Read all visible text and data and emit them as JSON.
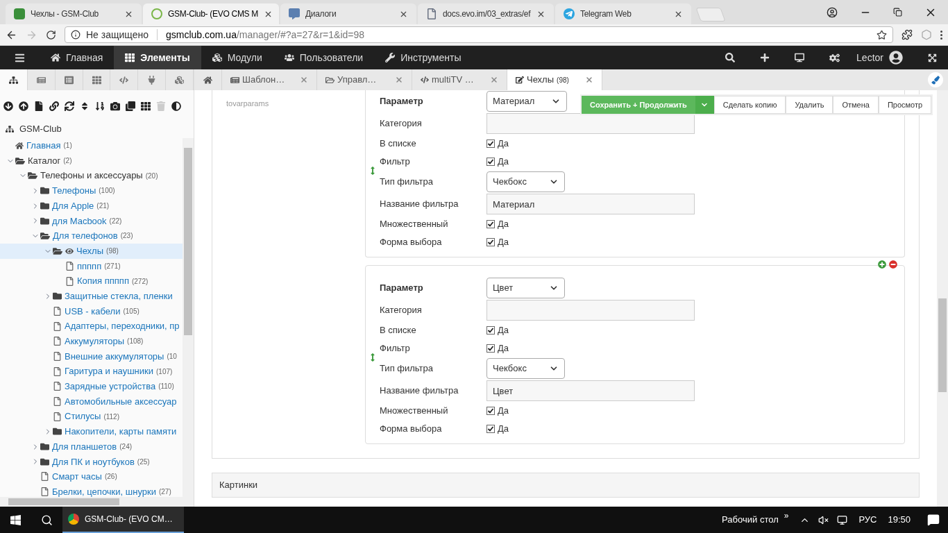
{
  "browser": {
    "tabs": [
      {
        "title": "Чехлы - GSM-Club",
        "kind": "gsm",
        "selected": false
      },
      {
        "title": "GSM-Club- (EVO CMS M",
        "kind": "evo",
        "selected": true
      },
      {
        "title": "Диалоги",
        "kind": "chat",
        "selected": false
      },
      {
        "title": "docs.evo.im/03_extras/ef",
        "kind": "doc",
        "selected": false
      },
      {
        "title": "Telegram Web",
        "kind": "telegram",
        "selected": false
      }
    ],
    "security": "Не защищено",
    "url_host": "gsmclub.com.ua",
    "url_path": "/manager/#?a=27&r=1&id=98"
  },
  "nav": {
    "items": [
      {
        "label": "Главная",
        "kind": "home",
        "selected": false
      },
      {
        "label": "Элементы",
        "kind": "elements",
        "selected": true
      },
      {
        "label": "Модули",
        "kind": "modules",
        "selected": false
      },
      {
        "label": "Пользователи",
        "kind": "users",
        "selected": false
      },
      {
        "label": "Инструменты",
        "kind": "tools",
        "selected": false
      }
    ],
    "user": "Lector"
  },
  "sidebar_tabs": [
    {
      "kind": "tree",
      "selected": true
    },
    {
      "kind": "templates",
      "selected": false
    },
    {
      "kind": "tvs",
      "selected": false
    },
    {
      "kind": "chunks",
      "selected": false
    },
    {
      "kind": "snippets",
      "selected": false
    },
    {
      "kind": "plugins",
      "selected": false
    },
    {
      "kind": "modules",
      "selected": false
    }
  ],
  "sidebar_toolbar": [
    {
      "kind": "expand",
      "disabled": false
    },
    {
      "kind": "collapse",
      "disabled": false
    },
    {
      "kind": "new",
      "disabled": false
    },
    {
      "kind": "link",
      "disabled": false
    },
    {
      "kind": "refresh",
      "disabled": false
    },
    {
      "kind": "sort",
      "disabled": false
    },
    {
      "kind": "order",
      "disabled": false
    },
    {
      "kind": "camera",
      "disabled": false
    },
    {
      "kind": "clone",
      "disabled": false
    },
    {
      "kind": "grid",
      "disabled": false
    },
    {
      "kind": "trash",
      "disabled": true
    },
    {
      "kind": "contrast",
      "disabled": false
    }
  ],
  "tree": {
    "root": "GSM-Club",
    "items": [
      {
        "label": "Главная",
        "count": "(1)",
        "kind": "home",
        "published": true,
        "selected": false
      },
      {
        "label": "Каталог",
        "count": "(2)",
        "kind": "folder",
        "published": false,
        "selected": false,
        "expanded": true,
        "children": [
          {
            "label": "Телефоны и аксессуары",
            "count": "(20)",
            "kind": "folder",
            "published": false,
            "selected": false,
            "expanded": true,
            "children": [
              {
                "label": "Телефоны",
                "count": "(100)",
                "kind": "folder",
                "published": true,
                "selected": false,
                "expanded": false
              },
              {
                "label": "Для Apple",
                "count": "(21)",
                "kind": "folder",
                "published": true,
                "selected": false,
                "expanded": false
              },
              {
                "label": "для Macbook",
                "count": "(22)",
                "kind": "folder",
                "published": true,
                "selected": false,
                "expanded": false
              },
              {
                "label": "Для телефонов",
                "count": "(23)",
                "kind": "folder",
                "published": true,
                "selected": false,
                "expanded": true,
                "children": [
                  {
                    "label": "Чехлы",
                    "count": "(98)",
                    "kind": "folder",
                    "published": true,
                    "selected": true,
                    "expanded": true,
                    "children": [
                      {
                        "label": "ппппп",
                        "count": "(271)",
                        "kind": "page",
                        "published": true,
                        "selected": false
                      },
                      {
                        "label": "Копия ппппп",
                        "count": "(272)",
                        "kind": "page",
                        "published": true,
                        "selected": false
                      }
                    ]
                  },
                  {
                    "label": "Защитные стекла, пленки",
                    "kind": "folder",
                    "published": true,
                    "selected": false,
                    "expanded": false
                  },
                  {
                    "label": "USB - кабели",
                    "count": "(105)",
                    "kind": "page",
                    "published": true,
                    "selected": false
                  },
                  {
                    "label": "Адаптеры, переходники, пр",
                    "kind": "page",
                    "published": true,
                    "selected": false
                  },
                  {
                    "label": "Аккумуляторы",
                    "count": "(108)",
                    "kind": "page",
                    "published": true,
                    "selected": false
                  },
                  {
                    "label": "Внешние аккумуляторы",
                    "count": "(10",
                    "kind": "page",
                    "published": true,
                    "selected": false
                  },
                  {
                    "label": "Гаритура и наушники",
                    "count": "(107)",
                    "kind": "page",
                    "published": true,
                    "selected": false
                  },
                  {
                    "label": "Зарядные устройства",
                    "count": "(110)",
                    "kind": "page",
                    "published": true,
                    "selected": false
                  },
                  {
                    "label": "Автомобильные аксессуар",
                    "kind": "page",
                    "published": true,
                    "selected": false
                  },
                  {
                    "label": "Стилусы",
                    "count": "(112)",
                    "kind": "page",
                    "published": true,
                    "selected": false
                  },
                  {
                    "label": "Накопители, карты памяти",
                    "kind": "folder",
                    "published": true,
                    "selected": false,
                    "expanded": false
                  }
                ]
              },
              {
                "label": "Для планшетов",
                "count": "(24)",
                "kind": "folder",
                "published": true,
                "selected": false,
                "expanded": false
              },
              {
                "label": "Для ПК и ноутбуков",
                "count": "(25)",
                "kind": "folder",
                "published": true,
                "selected": false,
                "expanded": false
              },
              {
                "label": "Смарт часы",
                "count": "(26)",
                "kind": "page",
                "published": true,
                "selected": false
              },
              {
                "label": "Брелки, цепочки, шнурки",
                "count": "(27)",
                "kind": "page",
                "published": true,
                "selected": false
              }
            ]
          }
        ]
      }
    ]
  },
  "doc_tabs": [
    {
      "kind": "home",
      "selected": false
    },
    {
      "title": "Шаблон…",
      "kind": "template",
      "selected": false
    },
    {
      "title": "Управл…",
      "kind": "folder",
      "selected": false
    },
    {
      "title": "multiTV …",
      "kind": "code",
      "selected": false
    },
    {
      "title": "Чехлы",
      "count": "(98)",
      "kind": "edit",
      "selected": true
    }
  ],
  "actions": {
    "save": "Сохранить + Продолжить",
    "buttons": [
      "Сделать копию",
      "Удалить",
      "Отмена",
      "Просмотр"
    ]
  },
  "tv_label": "tovarparams",
  "blocks": [
    {
      "controls": false,
      "fields": [
        {
          "label": "Параметр",
          "kind": "select",
          "value": "Материал",
          "strong": true
        },
        {
          "label": "Категория",
          "kind": "text",
          "strong": false
        },
        {
          "label": "В списке",
          "kind": "checkbox",
          "value": "Да",
          "checked": true,
          "strong": false
        },
        {
          "label": "Фильтр",
          "kind": "checkbox",
          "value": "Да",
          "checked": true,
          "strong": false
        },
        {
          "label": "Тип фильтра",
          "kind": "select",
          "value": "Чекбокс",
          "strong": false
        },
        {
          "label": "Название фильтра",
          "kind": "text",
          "value": "Материал",
          "strong": false
        },
        {
          "label": "Множественный",
          "kind": "checkbox",
          "value": "Да",
          "checked": true,
          "strong": false
        },
        {
          "label": "Форма выбора",
          "kind": "checkbox",
          "value": "Да",
          "checked": true,
          "strong": false
        }
      ]
    },
    {
      "controls": true,
      "fields": [
        {
          "label": "Параметр",
          "kind": "select",
          "value": "Цвет",
          "strong": true
        },
        {
          "label": "Категория",
          "kind": "text",
          "strong": false
        },
        {
          "label": "В списке",
          "kind": "checkbox",
          "value": "Да",
          "checked": true,
          "strong": false
        },
        {
          "label": "Фильтр",
          "kind": "checkbox",
          "value": "Да",
          "checked": true,
          "strong": false
        },
        {
          "label": "Тип фильтра",
          "kind": "select",
          "value": "Чекбокс",
          "strong": false
        },
        {
          "label": "Название фильтра",
          "kind": "text",
          "value": "Цвет",
          "strong": false
        },
        {
          "label": "Множественный",
          "kind": "checkbox",
          "value": "Да",
          "checked": true,
          "strong": false
        },
        {
          "label": "Форма выбора",
          "kind": "checkbox",
          "value": "Да",
          "checked": true,
          "strong": false
        }
      ]
    }
  ],
  "section": "Картинки",
  "taskbar": {
    "app": "GSM-Club- (EVO CM…",
    "desktop": "Рабочий стол",
    "more": "»",
    "lang": "РУС",
    "time": "19:50"
  }
}
